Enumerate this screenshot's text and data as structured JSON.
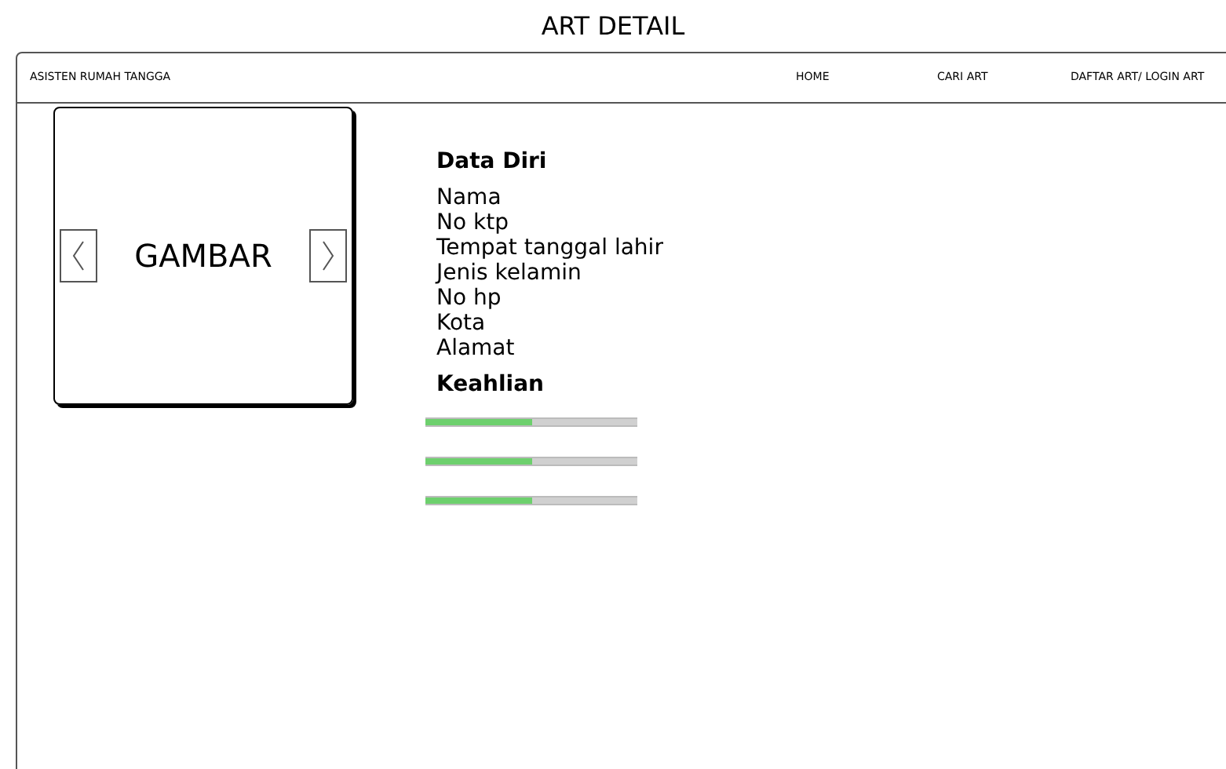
{
  "page_title": "ART DETAIL",
  "navbar": {
    "brand": "ASISTEN RUMAH TANGGA",
    "links": [
      "HOME",
      "CARI ART",
      "DAFTAR ART/ LOGIN ART"
    ]
  },
  "image_carousel": {
    "label": "GAMBAR"
  },
  "profile": {
    "heading": "Data Diri",
    "fields": [
      "Nama",
      "No ktp",
      "Tempat tanggal lahir",
      "Jenis kelamin",
      "No hp",
      "Kota",
      "Alamat"
    ]
  },
  "skills": {
    "heading": "Keahlian",
    "bars": [
      {
        "level": 0.5
      },
      {
        "level": 0.5
      },
      {
        "level": 0.5
      }
    ]
  }
}
